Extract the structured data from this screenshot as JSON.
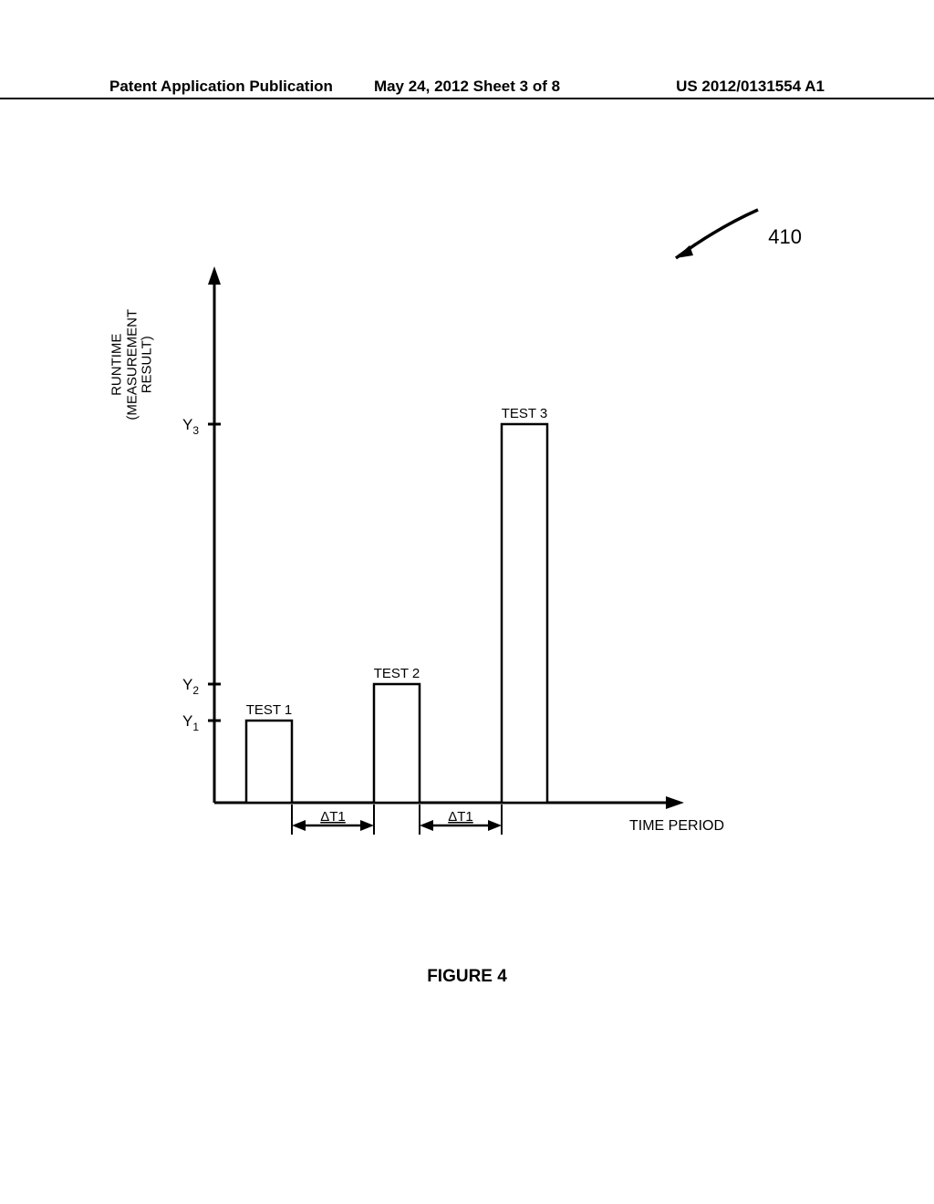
{
  "header": {
    "left": "Patent Application Publication",
    "center": "May 24, 2012  Sheet 3 of 8",
    "right": "US 2012/0131554 A1"
  },
  "reference_number": "410",
  "axes": {
    "y_label_line1": "RUNTIME",
    "y_label_line2": "(MEASUREMENT",
    "y_label_line3": "RESULT)",
    "y_tick_1": "Y",
    "y_sub_1": "1",
    "y_tick_2": "Y",
    "y_sub_2": "2",
    "y_tick_3": "Y",
    "y_sub_3": "3",
    "x_label": "TIME PERIOD",
    "delta_label": "ΔT1"
  },
  "bar_labels": {
    "t1": "TEST 1",
    "t2": "TEST 2",
    "t3": "TEST 3"
  },
  "figure_caption": "FIGURE 4",
  "chart_data": {
    "type": "bar",
    "categories": [
      "TEST 1",
      "TEST 2",
      "TEST 3"
    ],
    "series": [
      {
        "name": "Runtime",
        "values": [
          1,
          2,
          3
        ],
        "note": "Values correspond to tick labels Y1, Y2, Y3"
      }
    ],
    "title": "",
    "xlabel": "TIME PERIOD",
    "ylabel": "RUNTIME (MEASUREMENT RESULT)",
    "annotations": [
      "ΔT1 gap between TEST 1 and TEST 2",
      "ΔT1 gap between TEST 2 and TEST 3"
    ],
    "figure_ref": "410"
  }
}
